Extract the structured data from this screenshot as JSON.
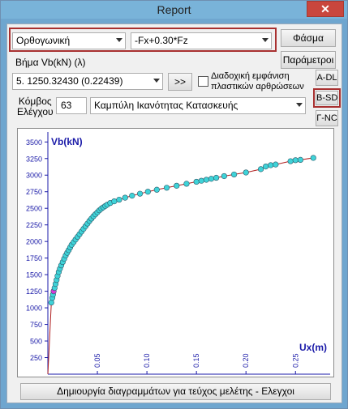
{
  "window": {
    "title": "Report",
    "close_glyph": "✕"
  },
  "controls": {
    "section_type": "Ορθογωνική",
    "load_combination": "-Fx+0.30*Fz",
    "spectrum_button": "Φάσμα",
    "parameters_button": "Παράμετροι",
    "step_label": "Βήμα  Vb(kN)  (λ)",
    "step_value": "5. 1250.32430 (0.22439)",
    "next_button": ">>",
    "sequential_checkbox_label_line1": "Διαδοχική εμφάνιση",
    "sequential_checkbox_label_line2": "πλαστικών αρθρώσεων",
    "sequential_checked": false,
    "ad_button": "A-DL",
    "bsd_button": "B-SD",
    "gnc_button": "Γ-NC",
    "node_label_line1": "Κόμβος",
    "node_label_line2": "Ελέγχου",
    "node_value": "63",
    "curve_type": "Καμπύλη Ικανότητας Κατασκευής",
    "generate_button": "Δημιουργία διαγραμμάτων για τεύχος μελέτης - Ελεγχοι"
  },
  "chart_data": {
    "type": "scatter",
    "ylabel": "Vb(kN)",
    "xlabel": "Ux(m)",
    "xlim": [
      0,
      0.285
    ],
    "ylim": [
      0,
      3650
    ],
    "y_ticks": [
      250,
      500,
      750,
      1000,
      1250,
      1500,
      1750,
      2000,
      2250,
      2500,
      2750,
      3000,
      3250,
      3500
    ],
    "x_ticks": [
      "0.05",
      "0.10",
      "0.15",
      "0.20",
      "0.25"
    ],
    "x_tick_values": [
      0.05,
      0.1,
      0.15,
      0.2,
      0.25
    ],
    "colors": {
      "points": "#3fd3d8",
      "highlight": "#d63bd6",
      "line": "#b02020",
      "axes": "#1a1aa8"
    },
    "highlight_index": 4,
    "points": [
      [
        0.0,
        0
      ],
      [
        0.0035,
        1080
      ],
      [
        0.0045,
        1150
      ],
      [
        0.0052,
        1200
      ],
      [
        0.0058,
        1250
      ],
      [
        0.0068,
        1300
      ],
      [
        0.0078,
        1360
      ],
      [
        0.0088,
        1420
      ],
      [
        0.0098,
        1480
      ],
      [
        0.011,
        1540
      ],
      [
        0.0122,
        1590
      ],
      [
        0.0135,
        1640
      ],
      [
        0.015,
        1690
      ],
      [
        0.0165,
        1740
      ],
      [
        0.018,
        1790
      ],
      [
        0.0195,
        1830
      ],
      [
        0.021,
        1870
      ],
      [
        0.0225,
        1910
      ],
      [
        0.024,
        1950
      ],
      [
        0.026,
        1990
      ],
      [
        0.028,
        2030
      ],
      [
        0.03,
        2070
      ],
      [
        0.032,
        2110
      ],
      [
        0.034,
        2150
      ],
      [
        0.036,
        2190
      ],
      [
        0.038,
        2230
      ],
      [
        0.04,
        2270
      ],
      [
        0.042,
        2310
      ],
      [
        0.044,
        2345
      ],
      [
        0.046,
        2380
      ],
      [
        0.048,
        2410
      ],
      [
        0.05,
        2440
      ],
      [
        0.052,
        2470
      ],
      [
        0.054,
        2495
      ],
      [
        0.056,
        2515
      ],
      [
        0.058,
        2535
      ],
      [
        0.06,
        2555
      ],
      [
        0.063,
        2580
      ],
      [
        0.067,
        2605
      ],
      [
        0.072,
        2630
      ],
      [
        0.078,
        2660
      ],
      [
        0.085,
        2690
      ],
      [
        0.093,
        2720
      ],
      [
        0.101,
        2750
      ],
      [
        0.11,
        2780
      ],
      [
        0.12,
        2810
      ],
      [
        0.13,
        2840
      ],
      [
        0.14,
        2870
      ],
      [
        0.15,
        2900
      ],
      [
        0.155,
        2915
      ],
      [
        0.16,
        2930
      ],
      [
        0.165,
        2945
      ],
      [
        0.17,
        2960
      ],
      [
        0.178,
        2985
      ],
      [
        0.188,
        3010
      ],
      [
        0.2,
        3040
      ],
      [
        0.215,
        3090
      ],
      [
        0.22,
        3130
      ],
      [
        0.225,
        3150
      ],
      [
        0.23,
        3160
      ],
      [
        0.245,
        3210
      ],
      [
        0.25,
        3225
      ],
      [
        0.255,
        3230
      ],
      [
        0.268,
        3260
      ]
    ]
  }
}
